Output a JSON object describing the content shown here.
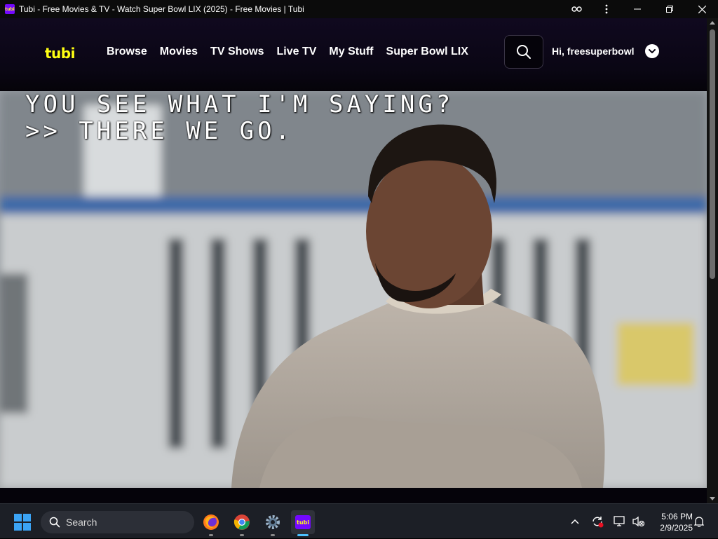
{
  "window": {
    "title": "Tubi - Free Movies & TV - Watch Super Bowl LIX (2025) - Free Movies | Tubi",
    "app_icon_text": "tubi"
  },
  "nav": {
    "logo": "tubi",
    "links": [
      "Browse",
      "Movies",
      "TV Shows",
      "Live TV",
      "My Stuff",
      "Super Bowl LIX"
    ],
    "user_greeting": "Hi, freesuperbowl",
    "search_icon": "search-icon",
    "menu_icon": "chevron-down-icon"
  },
  "player": {
    "captions": [
      "YOU SEE WHAT I'M SAYING?",
      ">> THERE WE GO."
    ]
  },
  "taskbar": {
    "search_placeholder": "Search",
    "apps": [
      "firefox-icon",
      "chrome-icon",
      "settings-icon",
      "tubi-icon"
    ],
    "active_app": "tubi",
    "tubi_icon_text": "tubi",
    "time": "5:06 PM",
    "date": "2/9/2025"
  },
  "colors": {
    "tubi_yellow": "#ffff13",
    "tubi_purple": "#7408ff",
    "nav_background": "#0a0614"
  }
}
